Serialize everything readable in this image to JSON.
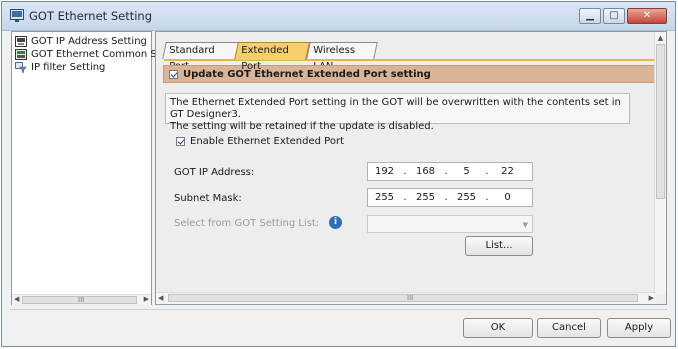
{
  "window": {
    "title": "GOT Ethernet Setting",
    "min_glyph": "▁",
    "max_glyph": "□",
    "close_glyph": "✕"
  },
  "tree": {
    "items": [
      {
        "label": "GOT IP Address Setting",
        "icon": "network-port-icon"
      },
      {
        "label": "GOT Ethernet Common S",
        "icon": "network-settings-icon"
      },
      {
        "label": "IP filter Setting",
        "icon": "filter-icon"
      }
    ],
    "scroll_grip": "III"
  },
  "tabs": [
    {
      "label": "Standard Port",
      "active": false
    },
    {
      "label": "Extended Port",
      "active": true
    },
    {
      "label": "Wireless LAN",
      "active": false
    }
  ],
  "extended_port": {
    "update_checkbox_label": "Update GOT Ethernet Extended Port setting",
    "update_checked": true,
    "info_line1": "The Ethernet Extended Port setting in the GOT will be overwritten with the contents set in GT Designer3.",
    "info_line2": "The setting will be retained if the update is disabled.",
    "enable_label": "Enable Ethernet Extended Port",
    "enable_checked": true,
    "ip_label": "GOT IP Address:",
    "ip": [
      "192",
      "168",
      "5",
      "22"
    ],
    "mask_label": "Subnet Mask:",
    "mask": [
      "255",
      "255",
      "255",
      "0"
    ],
    "select_label": "Select from GOT Setting List:",
    "info_icon_glyph": "i",
    "list_button": "List...",
    "octet_sep": "."
  },
  "scrollbars": {
    "grip": "III",
    "up": "▲",
    "left": "◀",
    "right": "▶",
    "down_arrow": "▼"
  },
  "footer": {
    "ok": "OK",
    "cancel": "Cancel",
    "apply": "Apply"
  },
  "colors": {
    "active_tab": "#f6cf6a",
    "header_bar": "#d9b497",
    "info_icon": "#2f6fb3"
  }
}
